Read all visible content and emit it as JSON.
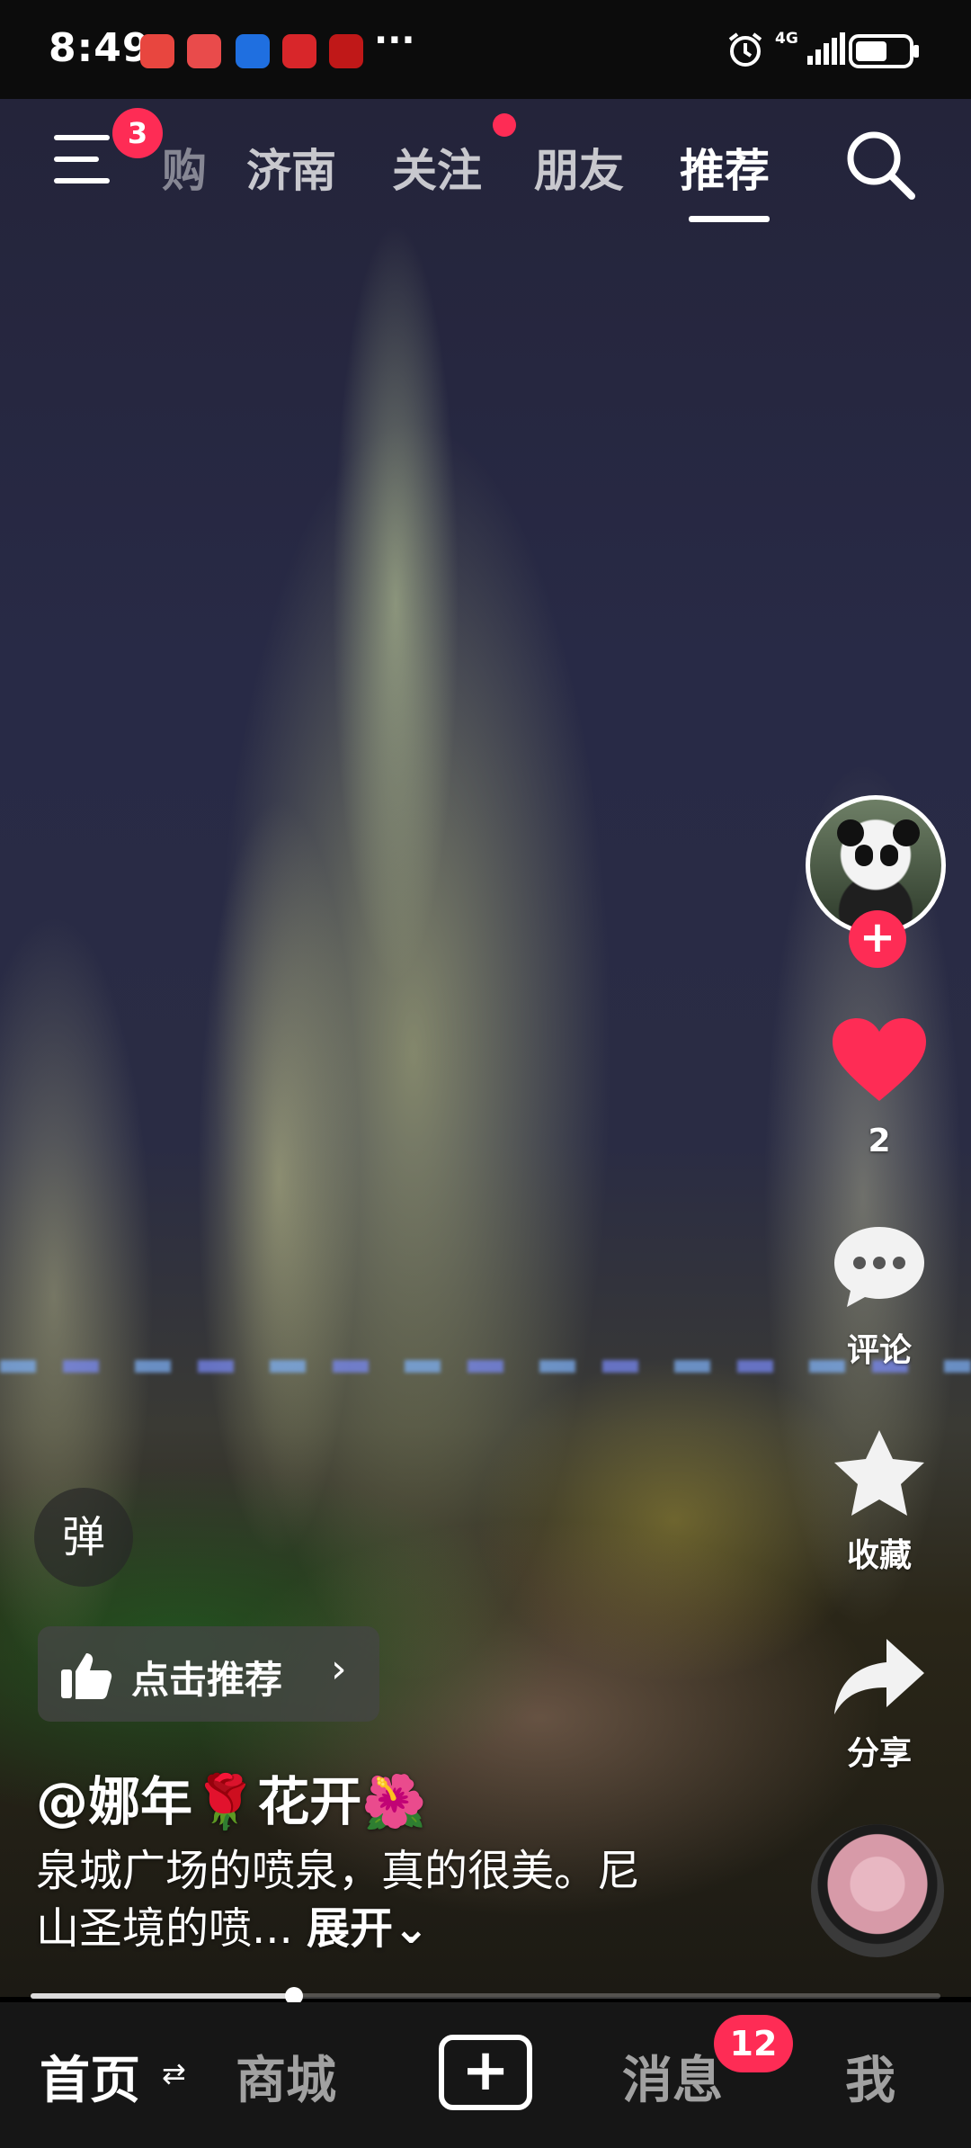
{
  "status_bar": {
    "time": "8:49",
    "more": "···",
    "network": "4G"
  },
  "top_nav": {
    "menu_badge": "3",
    "tabs": [
      {
        "label": "购",
        "active": false
      },
      {
        "label": "济南",
        "active": false
      },
      {
        "label": "关注",
        "active": false,
        "dot": true
      },
      {
        "label": "朋友",
        "active": false
      },
      {
        "label": "推荐",
        "active": true
      }
    ]
  },
  "right_rail": {
    "like_count": "2",
    "comment_label": "评论",
    "favorite_label": "收藏",
    "share_label": "分享",
    "follow_symbol": "+"
  },
  "video": {
    "danmu_label": "弹",
    "recommend_label": "点击推荐",
    "author": "@娜年🌹花开🌺",
    "description": "泉城广场的喷泉，真的很美。尼山圣境的喷...",
    "expand_label": "展开",
    "progress": 0.29
  },
  "bottom_tabs": {
    "home": "首页",
    "home_swap": "⇄",
    "mall": "商城",
    "add": "+",
    "messages": "消息",
    "messages_badge": "12",
    "me": "我"
  },
  "colors": {
    "accent": "#fe2c55",
    "tabbar_bg": "#161616"
  }
}
